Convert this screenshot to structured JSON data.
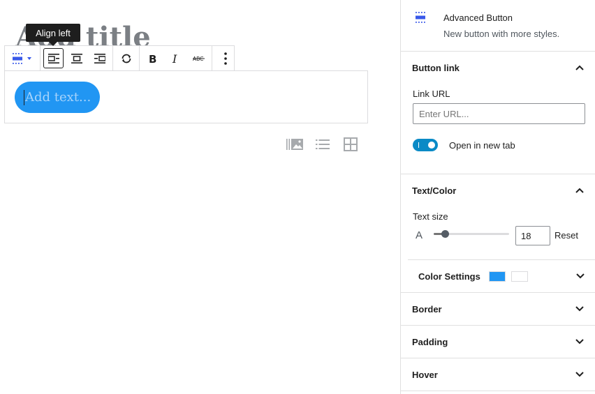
{
  "editor": {
    "post_title": "Add title",
    "tooltip": "Align left",
    "button_placeholder": "Add text...",
    "button_color": "#2196f3"
  },
  "toolbar": {
    "items": [
      {
        "name": "block-type",
        "icon": "advanced-button-icon"
      },
      {
        "name": "align-left",
        "icon": "align-left-icon",
        "active": true
      },
      {
        "name": "align-center",
        "icon": "align-center-icon"
      },
      {
        "name": "align-right",
        "icon": "align-right-icon"
      },
      {
        "name": "change-style",
        "icon": "refresh-icon"
      },
      {
        "name": "bold",
        "icon": "bold-icon"
      },
      {
        "name": "italic",
        "icon": "italic-icon"
      },
      {
        "name": "strikethrough",
        "icon": "strikethrough-icon"
      },
      {
        "name": "more-options",
        "icon": "more-vertical-icon"
      }
    ]
  },
  "inserter": {
    "icons": [
      "gallery-icon",
      "list-icon",
      "grid-icon"
    ]
  },
  "sidebar": {
    "block_card": {
      "title": "Advanced Button",
      "description": "New button with more styles."
    },
    "button_link": {
      "title": "Button link",
      "link_url_label": "Link URL",
      "url_placeholder": "Enter URL...",
      "url_value": "",
      "new_tab_label": "Open in new tab",
      "new_tab_on": true
    },
    "text_color": {
      "title": "Text/Color",
      "text_size_label": "Text size",
      "size_prefix": "A",
      "text_size": "18",
      "slider_fraction": 0.15,
      "reset_label": "Reset",
      "color_settings_label": "Color Settings",
      "swatch_1": "#2196f3",
      "swatch_2": "#ffffff"
    },
    "border": {
      "title": "Border"
    },
    "padding": {
      "title": "Padding"
    },
    "hover": {
      "title": "Hover"
    }
  },
  "colors": {
    "accent": "#2196f3",
    "toggle_on": "#0a8ac6",
    "text": "#1e1e1e",
    "border": "#e0e0e0"
  }
}
